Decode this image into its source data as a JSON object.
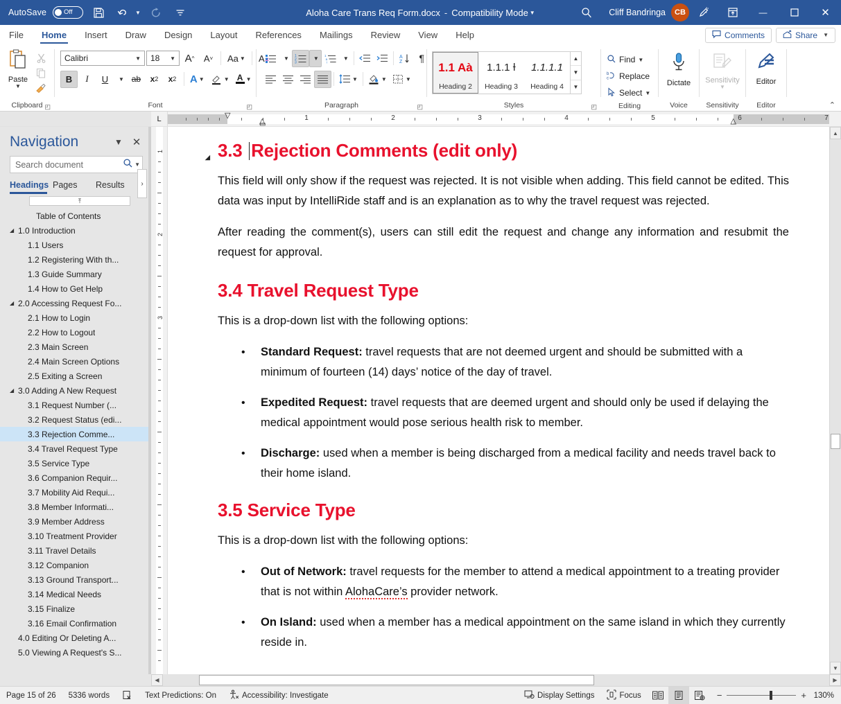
{
  "titlebar": {
    "autosave_label": "AutoSave",
    "autosave_state": "Off",
    "save_icon": "save-icon",
    "undo_icon": "undo-icon",
    "redo_icon": "redo-icon",
    "customize_qat_icon": "customize-quick-access-toolbar-icon",
    "doc_title": "Aloha Care Trans Req Form.docx",
    "separator": "-",
    "compat_mode": "Compatibility Mode",
    "search_icon": "search-icon",
    "user_name": "Cliff Bandringa",
    "user_initials": "CB",
    "ink_icon": "ink-pen-icon",
    "ribbon_display_icon": "ribbon-display-options-icon",
    "minimize": "—",
    "maximize": "☐",
    "close": "✕",
    "bar_color": "#2b579a",
    "avatar_color": "#ca5010"
  },
  "ribbon_tabs": {
    "items": [
      {
        "label": "File",
        "active": false
      },
      {
        "label": "Home",
        "active": true
      },
      {
        "label": "Insert",
        "active": false
      },
      {
        "label": "Draw",
        "active": false
      },
      {
        "label": "Design",
        "active": false
      },
      {
        "label": "Layout",
        "active": false
      },
      {
        "label": "References",
        "active": false
      },
      {
        "label": "Mailings",
        "active": false
      },
      {
        "label": "Review",
        "active": false
      },
      {
        "label": "View",
        "active": false
      },
      {
        "label": "Help",
        "active": false
      }
    ],
    "comments_label": "Comments",
    "share_label": "Share",
    "accent": "#2b579a"
  },
  "ribbon": {
    "clipboard": {
      "label": "Clipboard",
      "paste_label": "Paste",
      "cut_name": "cut-icon",
      "copy_name": "copy-icon",
      "format_painter_name": "format-painter-icon"
    },
    "font": {
      "label": "Font",
      "font_family_value": "Calibri",
      "font_size_value": "18",
      "grow_font": "A",
      "shrink_font": "A",
      "change_case": "Aa",
      "clear_formatting": "A",
      "bold": "B",
      "italic": "I",
      "underline": "U",
      "strikethrough": "ab",
      "subscript": "x",
      "superscript": "x",
      "text_effects": "A",
      "highlight": "highlight-icon",
      "font_color": "A",
      "bold_active": true
    },
    "paragraph": {
      "label": "Paragraph",
      "bullets": "bullets-icon",
      "numbering": "numbering-icon",
      "multilevel": "multilevel-list-icon",
      "decrease_indent": "decrease-indent-icon",
      "increase_indent": "increase-indent-icon",
      "sort": "sort-icon",
      "show_marks": "¶",
      "align_left": "align-left-icon",
      "align_center": "align-center-icon",
      "align_right": "align-right-icon",
      "justify": "justify-icon",
      "line_spacing": "line-spacing-icon",
      "shading": "shading-icon",
      "borders": "borders-icon",
      "numbering_active": true,
      "justify_active": true
    },
    "styles": {
      "label": "Styles",
      "items": [
        {
          "preview": "1.1  Aà",
          "name": "Heading 2",
          "selected": true
        },
        {
          "preview": "1.1.1  Ɨ",
          "name": "Heading 3",
          "selected": false
        },
        {
          "preview": "1.1.1.1",
          "name": "Heading 4",
          "selected": false
        }
      ]
    },
    "editing": {
      "label": "Editing",
      "find_label": "Find",
      "replace_label": "Replace",
      "select_label": "Select"
    },
    "voice": {
      "label": "Voice",
      "dictate_label": "Dictate"
    },
    "sensitivity": {
      "label": "Sensitivity",
      "button_label": "Sensitivity",
      "disabled": true
    },
    "editor": {
      "label": "Editor",
      "button_label": "Editor"
    },
    "collapse_icon": "collapse-ribbon-icon"
  },
  "ruler": {
    "tabstop_marker": "L",
    "numbers": [
      "1",
      "2",
      "3",
      "4",
      "5",
      "6",
      "7"
    ],
    "vertical_numbers": [
      "1",
      "2",
      "3"
    ]
  },
  "navigation": {
    "title": "Navigation",
    "dropdown_icon": "chevron-down-icon",
    "close_icon": "close-icon",
    "search_placeholder": "Search document",
    "search_value": "",
    "search_icon": "search-icon",
    "search_dropdown_icon": "chevron-down-icon",
    "tabs": [
      {
        "label": "Headings",
        "active": true
      },
      {
        "label": "Pages",
        "active": false
      },
      {
        "label": "Results",
        "active": false
      }
    ],
    "more_tabs_icon": "chevron-right-icon",
    "scroll_up_icon": "scroll-to-top-icon",
    "items": [
      {
        "label": "Table of Contents",
        "level": 2,
        "expandable": false,
        "selected": false
      },
      {
        "label": "1.0 Introduction",
        "level": 1,
        "expandable": true,
        "selected": false
      },
      {
        "label": "1.1 Users",
        "level": 2,
        "expandable": false,
        "selected": false
      },
      {
        "label": "1.2 Registering With th...",
        "level": 2,
        "expandable": false,
        "selected": false
      },
      {
        "label": "1.3 Guide Summary",
        "level": 2,
        "expandable": false,
        "selected": false
      },
      {
        "label": "1.4 How to Get Help",
        "level": 2,
        "expandable": false,
        "selected": false
      },
      {
        "label": "2.0 Accessing Request Fo...",
        "level": 1,
        "expandable": true,
        "selected": false
      },
      {
        "label": "2.1 How to Login",
        "level": 2,
        "expandable": false,
        "selected": false
      },
      {
        "label": "2.2 How to Logout",
        "level": 2,
        "expandable": false,
        "selected": false
      },
      {
        "label": "2.3 Main Screen",
        "level": 2,
        "expandable": false,
        "selected": false
      },
      {
        "label": "2.4 Main Screen Options",
        "level": 2,
        "expandable": false,
        "selected": false
      },
      {
        "label": "2.5 Exiting a Screen",
        "level": 2,
        "expandable": false,
        "selected": false
      },
      {
        "label": "3.0 Adding A New Request",
        "level": 1,
        "expandable": true,
        "selected": false
      },
      {
        "label": "3.1 Request Number (...",
        "level": 2,
        "expandable": false,
        "selected": false
      },
      {
        "label": "3.2 Request Status (edi...",
        "level": 2,
        "expandable": false,
        "selected": false
      },
      {
        "label": "3.3 Rejection Comme...",
        "level": 2,
        "expandable": false,
        "selected": true
      },
      {
        "label": "3.4 Travel Request Type",
        "level": 2,
        "expandable": false,
        "selected": false
      },
      {
        "label": "3.5 Service Type",
        "level": 2,
        "expandable": false,
        "selected": false
      },
      {
        "label": "3.6 Companion Requir...",
        "level": 2,
        "expandable": false,
        "selected": false
      },
      {
        "label": "3.7 Mobility Aid Requi...",
        "level": 2,
        "expandable": false,
        "selected": false
      },
      {
        "label": "3.8 Member Informati...",
        "level": 2,
        "expandable": false,
        "selected": false
      },
      {
        "label": "3.9 Member Address",
        "level": 2,
        "expandable": false,
        "selected": false
      },
      {
        "label": "3.10 Treatment Provider",
        "level": 2,
        "expandable": false,
        "selected": false
      },
      {
        "label": "3.11 Travel Details",
        "level": 2,
        "expandable": false,
        "selected": false
      },
      {
        "label": "3.12 Companion",
        "level": 2,
        "expandable": false,
        "selected": false
      },
      {
        "label": "3.13 Ground Transport...",
        "level": 2,
        "expandable": false,
        "selected": false
      },
      {
        "label": "3.14 Medical Needs",
        "level": 2,
        "expandable": false,
        "selected": false
      },
      {
        "label": "3.15 Finalize",
        "level": 2,
        "expandable": false,
        "selected": false
      },
      {
        "label": "3.16 Email Confirmation",
        "level": 2,
        "expandable": false,
        "selected": false
      },
      {
        "label": "4.0 Editing Or Deleting A...",
        "level": 1,
        "expandable": false,
        "selected": false
      },
      {
        "label": "5.0 Viewing A Request's S...",
        "level": 1,
        "expandable": false,
        "selected": false
      }
    ],
    "selection_color": "#cce4f7",
    "title_color": "#2b579a"
  },
  "document": {
    "heading_color": "#e8112d",
    "blocks": [
      {
        "type": "h2",
        "number": "3.3",
        "text": "Rejection Comments (edit only)",
        "has_caret": true,
        "has_collapse_triangle": true
      },
      {
        "type": "p",
        "text": "This field will only show if the request was rejected. It is not visible when adding. This field cannot be edited. This data was input by IntelliRide staff and is an explanation as to why the travel request was rejected."
      },
      {
        "type": "p",
        "text": "After reading the comment(s), users can still edit the request and change any information and resubmit the request for approval."
      },
      {
        "type": "h2",
        "number": "3.4",
        "text": "Travel Request Type",
        "has_caret": false,
        "has_collapse_triangle": false
      },
      {
        "type": "p",
        "text": "This is a drop-down list with the following options:"
      },
      {
        "type": "ul",
        "items": [
          {
            "bold": "Standard Request:",
            "text": " travel requests that are not deemed urgent and should be submitted with a minimum of fourteen (14) days’ notice of the day of travel."
          },
          {
            "bold": "Expedited Request:",
            "text": " travel requests that are deemed urgent and should only be used if delaying the medical appointment would pose serious health risk to member."
          },
          {
            "bold": "Discharge:",
            "text": " used when a member is being discharged from a medical facility and needs travel back to their home island."
          }
        ]
      },
      {
        "type": "h2",
        "number": "3.5",
        "text": "Service Type",
        "has_caret": false,
        "has_collapse_triangle": false
      },
      {
        "type": "p",
        "text": "This is a drop-down list with the following options:"
      },
      {
        "type": "ul",
        "items": [
          {
            "bold": "Out of Network:",
            "text": " travel requests for the member to attend a medical appointment to a treating provider that is not within AlohaCare’s provider network.",
            "misspelled": "AlohaCare’s"
          },
          {
            "bold": "On Island:",
            "text": " used when a member has a medical appointment on the same island in which they currently reside in."
          }
        ]
      }
    ]
  },
  "statusbar": {
    "page_info": "Page 15 of 26",
    "word_count": "5336 words",
    "proofing_icon": "proofing-errors-icon",
    "text_predictions": "Text Predictions: On",
    "accessibility_icon": "accessibility-icon",
    "accessibility": "Accessibility: Investigate",
    "display_settings_icon": "display-settings-icon",
    "display_settings": "Display Settings",
    "focus_icon": "focus-mode-icon",
    "focus": "Focus",
    "view_read_icon": "read-mode-icon",
    "view_print_icon": "print-layout-icon",
    "view_web_icon": "web-layout-icon",
    "active_view": "print-layout-icon",
    "zoom_out": "−",
    "zoom_in": "+",
    "zoom_level": "130%"
  }
}
